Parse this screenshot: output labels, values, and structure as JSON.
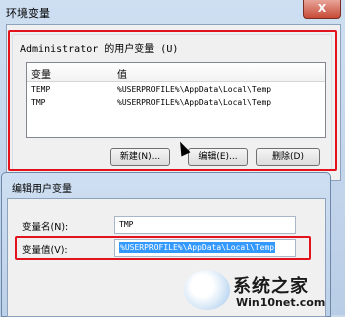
{
  "dialog1": {
    "title": "环境变量",
    "close_label": "X",
    "group_label": "Administrator 的用户变量 (U)",
    "columns": [
      "变量",
      "值"
    ],
    "rows": [
      {
        "name": "TEMP",
        "value": "%USERPROFILE%\\AppData\\Local\\Temp"
      },
      {
        "name": "TMP",
        "value": "%USERPROFILE%\\AppData\\Local\\Temp"
      }
    ],
    "buttons": {
      "new": "新建(N)...",
      "edit": "编辑(E)...",
      "delete": "删除(D)"
    }
  },
  "dialog2": {
    "title": "编辑用户变量",
    "name_label": "变量名(N):",
    "name_value": "TMP",
    "value_label": "变量值(V):",
    "value_value": "%USERPROFILE%\\AppData\\Local\\Temp"
  },
  "watermark": {
    "title": "系统之家",
    "subtitle": "Win10net.com"
  },
  "colors": {
    "highlight_box": "#e2131d",
    "selection": "#3399ff"
  }
}
